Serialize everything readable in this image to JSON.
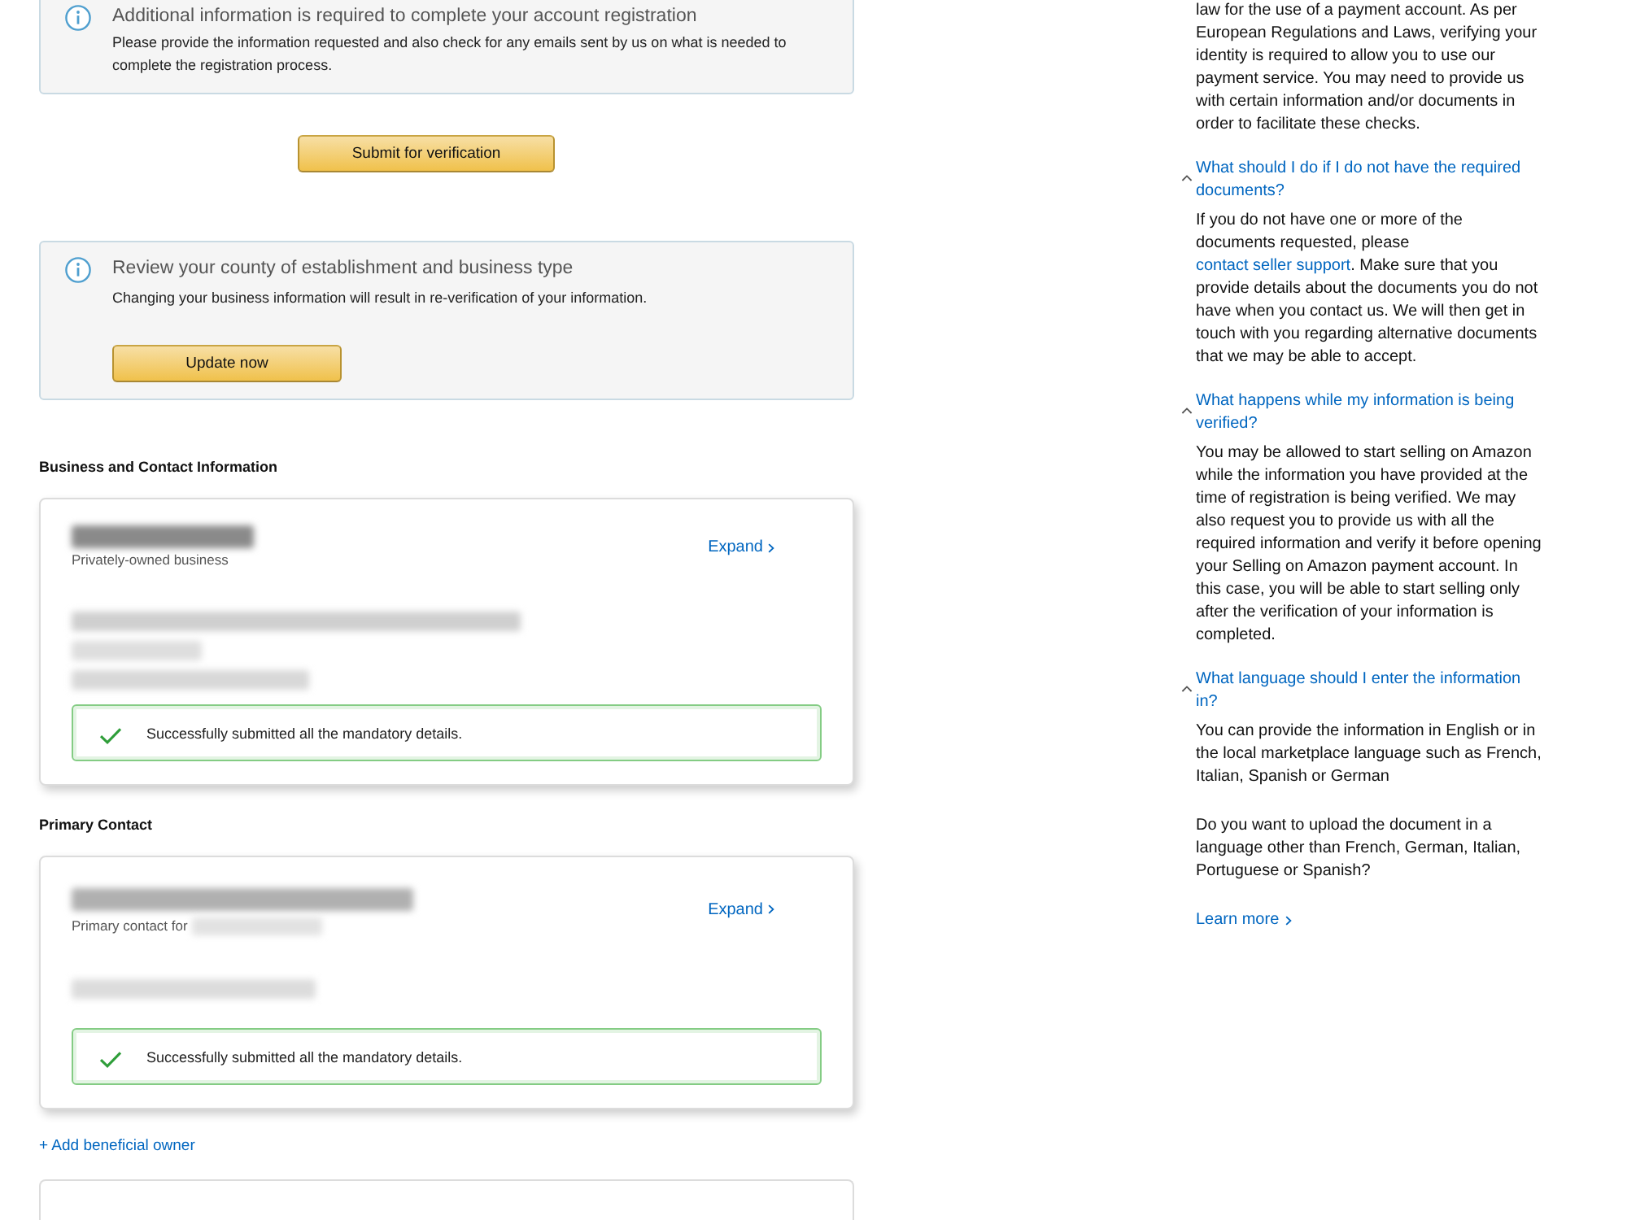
{
  "registration_alert": {
    "kind": "info",
    "title": "Additional information is required to complete your account registration",
    "text": "Please provide the information requested and also check for any emails sent by us on what is needed to complete the registration process."
  },
  "submit_button": "Submit for verification",
  "review_alert": {
    "kind": "info",
    "title": "Review your county of establishment and business type",
    "text": "Changing your business information will result in re-verification of your information.",
    "button": "Update now"
  },
  "sections": [
    {
      "heading": "Business and Contact Information",
      "card": {
        "kind": "business",
        "subtitle": "Privately-owned business",
        "expand_label": "Expand",
        "status": {
          "kind": "success",
          "text": "Successfully submitted all the mandatory details."
        }
      }
    },
    {
      "heading": "Primary Contact",
      "card": {
        "kind": "contact",
        "subtitle": "Primary contact for",
        "expand_label": "Expand",
        "status": {
          "kind": "success",
          "text": "Successfully submitted all the mandatory details."
        }
      }
    }
  ],
  "add_beneficial_owner": "+ Add beneficial owner",
  "next_card_visible": true,
  "help": {
    "intro_tail": "law for the use of a payment account. As per European Regulations and Laws, verifying your identity is required to allow you to use our payment service. You may need to provide us with certain information and/or documents in order to facilitate these checks.",
    "faqs": [
      {
        "question": "What should I do if I do not have the required documents?",
        "expanded": true,
        "answer": [
          {
            "kind": "text",
            "text": "If you do not have one or more of the documents requested, please "
          },
          {
            "kind": "link",
            "text": "contact seller support"
          },
          {
            "kind": "text",
            "text": ". Make sure that you provide details about the documents you do not have when you contact us. We will then get in touch with you regarding alternative documents that we may be able to accept."
          }
        ]
      },
      {
        "question": "What happens while my information is being verified?",
        "expanded": true,
        "answer": [
          {
            "kind": "text",
            "text": "You may be allowed to start selling on Amazon while the information you have provided at the time of registration is being verified. We may also request you to provide us with all the required information and verify it before opening your Selling on Amazon payment account. In this case, you will be able to start selling only after the verification of your information is completed."
          }
        ]
      },
      {
        "question": "What language should I enter the information in?",
        "expanded": true,
        "answer": [
          {
            "kind": "text",
            "text": "You can provide the information in English or in the local marketplace language such as French, Italian, Spanish or German"
          }
        ]
      }
    ],
    "upload_question": "Do you want to upload the document in a language other than French, German, Italian, Portuguese or Spanish?",
    "learn_more": "Learn more"
  }
}
